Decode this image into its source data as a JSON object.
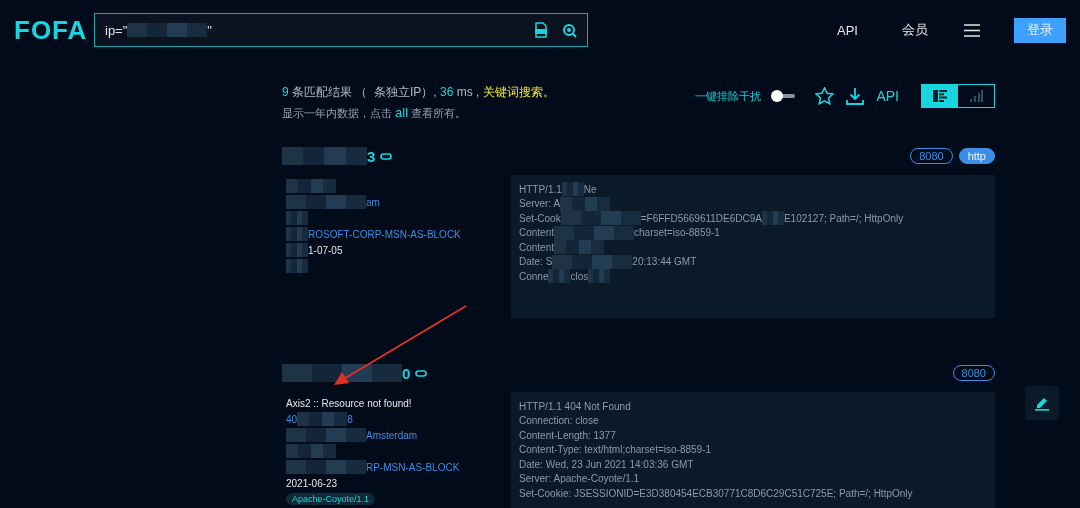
{
  "header": {
    "logo": "FOFA",
    "search": {
      "value_parts": [
        {
          "kind": "text",
          "text": "ip=\""
        },
        {
          "kind": "mask_l"
        },
        {
          "kind": "text",
          "text": "\""
        }
      ]
    },
    "nav": [
      "API",
      "会员"
    ],
    "login": "登录"
  },
  "summary": {
    "parts": [
      {
        "kind": "number",
        "text": "9"
      },
      {
        "kind": "plain",
        "text": " 条匹配结果 （"
      },
      {
        "kind": "plain",
        "text": "  条独立IP）, "
      },
      {
        "kind": "number",
        "text": "36"
      },
      {
        "kind": "plain",
        "text": " ms , "
      },
      {
        "kind": "highlight",
        "text": "关键词搜索。"
      }
    ],
    "note_before": "显示一年内数据，点击 ",
    "note_link": "all",
    "note_after": " 查看所有。"
  },
  "tools": {
    "filter_label": "一键排除干扰",
    "filter_on": false,
    "api": "API",
    "views": [
      {
        "kind": "list",
        "selected": true
      },
      {
        "kind": "chart",
        "selected": false
      }
    ]
  },
  "results": [
    {
      "title_end": "3",
      "tags": [
        {
          "text": "8080",
          "kind": "outline"
        },
        {
          "text": "http",
          "kind": "filled"
        }
      ],
      "left": [
        [
          {
            "kind": "mask_m"
          }
        ],
        [
          {
            "kind": "mask_l"
          },
          {
            "kind": "link",
            "text": "am"
          }
        ],
        [
          {
            "kind": "mask_s"
          }
        ],
        [
          {
            "kind": "mask_s"
          },
          {
            "kind": "link",
            "text": "ROSOFT-CORP-MSN-AS-BLOCK"
          }
        ],
        [
          {
            "kind": "mask_s"
          },
          {
            "kind": "plain",
            "text": "1-07-05"
          }
        ],
        [
          {
            "kind": "mask_s"
          }
        ]
      ],
      "response": [
        [
          {
            "kind": "text",
            "text": "HTTP/1.1"
          },
          {
            "kind": "mask_s"
          },
          {
            "kind": "text",
            "text": "Ne"
          }
        ],
        [
          {
            "kind": "text",
            "text": "Server: A"
          },
          {
            "kind": "mask_m"
          }
        ],
        [
          {
            "kind": "text",
            "text": "Set-Cook"
          },
          {
            "kind": "mask_l"
          },
          {
            "kind": "text",
            "text": "=F6FFD5669611DE6DC9A"
          },
          {
            "kind": "mask_s"
          },
          {
            "kind": "text",
            "text": "E102127; Path=/; HttpOnly"
          }
        ],
        [
          {
            "kind": "text",
            "text": "Content"
          },
          {
            "kind": "mask_l"
          },
          {
            "kind": "text",
            "text": "charset=iso-8859-1"
          }
        ],
        [
          {
            "kind": "text",
            "text": "Content"
          },
          {
            "kind": "mask_m"
          }
        ],
        [
          {
            "kind": "text",
            "text": "Date: S"
          },
          {
            "kind": "mask_l"
          },
          {
            "kind": "text",
            "text": "20:13:44 GMT"
          }
        ],
        [
          {
            "kind": "text",
            "text": "Conne"
          },
          {
            "kind": "mask_s"
          },
          {
            "kind": "text",
            "text": "clos"
          },
          {
            "kind": "mask_s"
          }
        ]
      ]
    },
    {
      "title_end": "0",
      "tags": [
        {
          "text": "8080",
          "kind": "outline"
        }
      ],
      "left": [
        [
          {
            "kind": "plain",
            "text": "Axis2 :: Resource not found!"
          }
        ],
        [
          {
            "kind": "link",
            "text": "40"
          },
          {
            "kind": "mask_m"
          },
          {
            "kind": "link",
            "text": "8"
          }
        ],
        [
          {
            "kind": "mask_l"
          },
          {
            "kind": "link",
            "text": "Amsterdam"
          }
        ],
        [
          {
            "kind": "mask_m"
          }
        ],
        [
          {
            "kind": "mask_l"
          },
          {
            "kind": "link",
            "text": "RP-MSN-AS-BLOCK"
          }
        ],
        [
          {
            "kind": "plain",
            "text": "2021-06-23"
          }
        ]
      ],
      "server_tag": "Apache-Coyote/1.1",
      "response": [
        [
          {
            "kind": "text",
            "text": "HTTP/1.1 404 Not Found"
          }
        ],
        [
          {
            "kind": "text",
            "text": "Connection: close"
          }
        ],
        [
          {
            "kind": "text",
            "text": "Content-Length: 1377"
          }
        ],
        [
          {
            "kind": "text",
            "text": "Content-Type: text/html;charset=iso-8859-1"
          }
        ],
        [
          {
            "kind": "text",
            "text": "Date: Wed, 23 Jun 2021 14:03:36 GMT"
          }
        ],
        [
          {
            "kind": "text",
            "text": "Server: Apache-Coyote/1.1"
          }
        ],
        [
          {
            "kind": "text",
            "text": "Set-Cookie: JSESSIONID=E3D380454ECB30771C8D6C29C51C725E; Path=/; HttpOnly"
          }
        ]
      ]
    }
  ],
  "annotation": {
    "kind": "arrow"
  }
}
